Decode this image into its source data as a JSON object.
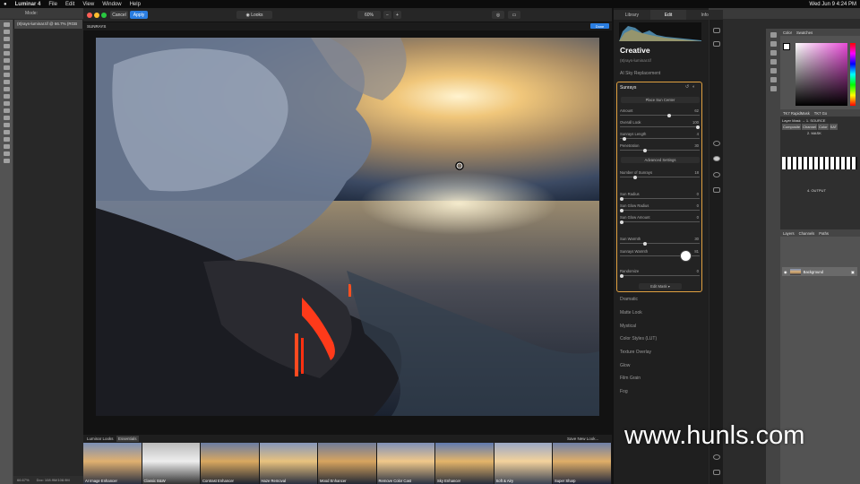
{
  "menubar": {
    "app": "Luminar 4",
    "items": [
      "File",
      "Edit",
      "View",
      "Window",
      "Help"
    ],
    "clock": "Wed Jun 9  4:24 PM"
  },
  "ps": {
    "doc_tab": "(8)rays-luminar.tif @ 66.7% (RGB",
    "zoom": "66.67%",
    "doc_size": "Doc: 108.9M/108.9M",
    "mode": "Mode:"
  },
  "lum": {
    "cancel": "Cancel",
    "apply": "Apply",
    "looks": "Looks",
    "zoom": "60%",
    "tool_name": "SUNRAYS",
    "done": "Done"
  },
  "rp": {
    "tabs": [
      "Library",
      "Edit",
      "Info"
    ],
    "title": "Creative",
    "file": "(8)rays-luminar.tif",
    "ai_sky": "AI Sky Replacement",
    "sunrays": {
      "name": "Sunrays",
      "place_btn": "Place Sun Center",
      "adv_btn": "Advanced Settings",
      "edit_mask": "Edit Mask ▾",
      "sliders": [
        {
          "label": "Amount",
          "value": "62",
          "pos": 0.62
        },
        {
          "label": "Overall Look",
          "value": "100",
          "pos": 1.0
        },
        {
          "label": "Sunrays Length",
          "value": "4",
          "pos": 0.04
        },
        {
          "label": "Penetration",
          "value": "30",
          "pos": 0.3
        },
        {
          "label": "Number of Sunrays",
          "value": "18",
          "pos": 0.18
        },
        {
          "label": "Sun Radius",
          "value": "0",
          "pos": 0.0
        },
        {
          "label": "Sun Glow Radius",
          "value": "0",
          "pos": 0.0
        },
        {
          "label": "Sun Glow Amount",
          "value": "0",
          "pos": 0.0
        },
        {
          "label": "Sun Warmth",
          "value": "30",
          "pos": 0.3
        },
        {
          "label": "Sunrays Warmth",
          "value": "81",
          "pos": 0.81
        },
        {
          "label": "Randomize",
          "value": "0",
          "pos": 0.0
        }
      ]
    },
    "sections": [
      "Dramatic",
      "Matte Look",
      "Mystical",
      "Color Styles (LUT)",
      "Texture Overlay",
      "Glow",
      "Film Grain",
      "Fog"
    ]
  },
  "film": {
    "tab1": "Luminar Looks",
    "tab2": "Essentials",
    "save": "Save New Look...",
    "items": [
      "AI Image Enhancer",
      "Classic B&W",
      "Contrast Enhancer",
      "Haze Removal",
      "Mood Enhancer",
      "Remove Color Cast",
      "Sky Enhancer",
      "Soft & Airy",
      "Super Sharp"
    ]
  },
  "psr": {
    "color": "Color",
    "swatches": "Swatches",
    "panel_a": "TK7 RapidMask",
    "panel_b": "TK7 Go",
    "layer_mask": "Layer Mask →  1. SOURCE",
    "composite": "Composite",
    "channel": "Channel",
    "color2": "Color",
    "sat": "SAT",
    "masks": "2. MASK",
    "output": "4. OUTPUT",
    "layers": "Layers",
    "channels": "Channels",
    "paths": "Paths",
    "background": "Background"
  },
  "watermark": "www.hunls.com"
}
